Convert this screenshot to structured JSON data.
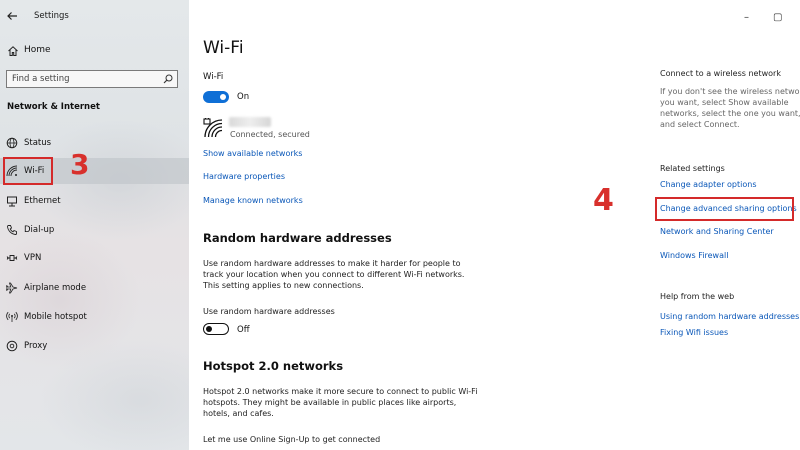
{
  "window": {
    "title": "Settings",
    "minimize_glyph": "–",
    "maximize_glyph": "▢"
  },
  "sidebar": {
    "home_label": "Home",
    "search_placeholder": "Find a setting",
    "section_label": "Network & Internet",
    "items": [
      {
        "label": "Status",
        "icon": "globe-icon"
      },
      {
        "label": "Wi-Fi",
        "icon": "wifi-icon",
        "selected": true
      },
      {
        "label": "Ethernet",
        "icon": "ethernet-icon"
      },
      {
        "label": "Dial-up",
        "icon": "phone-icon"
      },
      {
        "label": "VPN",
        "icon": "vpn-icon"
      },
      {
        "label": "Airplane mode",
        "icon": "airplane-icon"
      },
      {
        "label": "Mobile hotspot",
        "icon": "hotspot-icon"
      },
      {
        "label": "Proxy",
        "icon": "proxy-icon"
      }
    ]
  },
  "annotations": {
    "step3": "3",
    "step4": "4",
    "accent": "#d42a2a"
  },
  "main": {
    "title": "Wi-Fi",
    "wifi_label": "Wi-Fi",
    "wifi_toggle_text": "On",
    "network_status": "Connected, secured",
    "links": {
      "show_networks": "Show available networks",
      "hardware_props": "Hardware properties",
      "manage_networks": "Manage known networks"
    },
    "random_hw": {
      "title": "Random hardware addresses",
      "description": "Use random hardware addresses to make it harder for people to track your location when you connect to different Wi-Fi networks. This setting applies to new connections.",
      "option_label": "Use random hardware addresses",
      "toggle_text": "Off"
    },
    "hotspot": {
      "title": "Hotspot 2.0 networks",
      "description": "Hotspot 2.0 networks make it more secure to connect to public Wi-Fi hotspots. They might be available in public places like airports, hotels, and cafes.",
      "option_label": "Let me use Online Sign-Up to get connected"
    }
  },
  "right": {
    "connect_heading": "Connect to a wireless network",
    "connect_text": "If you don't see the wireless network you want, select Show available networks, select the one you want, and select Connect.",
    "related_heading": "Related settings",
    "related_links": [
      "Change adapter options",
      "Change advanced sharing options",
      "Network and Sharing Center",
      "Windows Firewall"
    ],
    "help_heading": "Help from the web",
    "help_links": [
      "Using random hardware addresses",
      "Fixing Wifi issues"
    ]
  },
  "colors": {
    "link": "#0a57b8",
    "toggle_on": "#0f6fd6"
  }
}
